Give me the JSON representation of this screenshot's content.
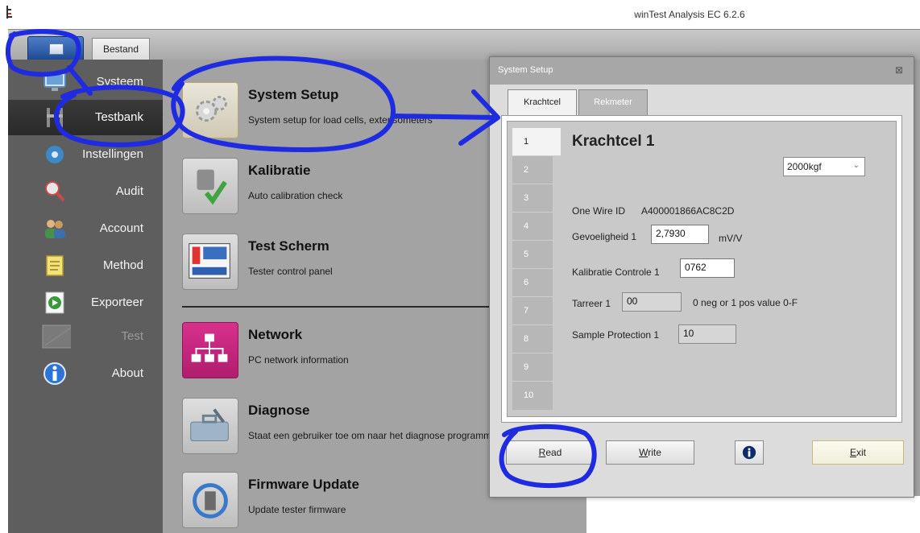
{
  "window": {
    "title": "winTest Analysis EC 6.2.6"
  },
  "ribbon": {
    "tab_bestand": "Bestand"
  },
  "sidebar": {
    "items": [
      {
        "label": "Systeem",
        "icon": "monitor-icon"
      },
      {
        "label": "Testbank",
        "icon": "test-bench-icon"
      },
      {
        "label": "Instellingen",
        "icon": "settings-icon"
      },
      {
        "label": "Audit",
        "icon": "magnifier-icon"
      },
      {
        "label": "Account",
        "icon": "users-icon"
      },
      {
        "label": "Method",
        "icon": "notes-icon"
      },
      {
        "label": "Exporteer",
        "icon": "export-icon"
      },
      {
        "label": "Test",
        "icon": "test-icon"
      },
      {
        "label": "About",
        "icon": "info-icon"
      }
    ]
  },
  "entries": [
    {
      "title": "System Setup",
      "desc": "System setup for load cells, extensometers"
    },
    {
      "title": "Kalibratie",
      "desc": "Auto calibration check"
    },
    {
      "title": "Test Scherm",
      "desc": "Tester control panel"
    },
    {
      "title": "Network",
      "desc": "PC network information"
    },
    {
      "title": "Diagnose",
      "desc": "Staat een gebruiker toe om naar het diagnose programma"
    },
    {
      "title": "Firmware Update",
      "desc": "Update tester firmware"
    }
  ],
  "dialog": {
    "title": "System Setup",
    "close_glyph": "⊠",
    "tabs": [
      "Krachtcel",
      "Rekmeter"
    ],
    "numbers": [
      "1",
      "2",
      "3",
      "4",
      "5",
      "6",
      "7",
      "8",
      "9",
      "10"
    ],
    "cell_title": "Krachtcel 1",
    "unit_select": "2000kgf",
    "one_wire_label": "One Wire ID",
    "one_wire_value": "A400001866AC8C2D",
    "gevoeligheid_label": "Gevoeligheid 1",
    "gevoeligheid_value": "2,7930",
    "gevoeligheid_unit": "mV/V",
    "kalibratie_label": "Kalibratie Controle 1",
    "kalibratie_value": "0762",
    "tarreer_label": "Tarreer 1",
    "tarreer_value": "00",
    "tarreer_hint": "0 neg or 1 pos value 0-F",
    "sample_label": "Sample Protection 1",
    "sample_value": "10",
    "buttons": {
      "read_first": "R",
      "read_rest": "ead",
      "write_first": "W",
      "write_rest": "rite",
      "exit_first": "E",
      "exit_rest": "xit"
    }
  },
  "colors": {
    "annotation_blue": "#1f2be0",
    "sidebar_bg": "#5e5e5e",
    "content_bg": "#a3a3a3"
  }
}
